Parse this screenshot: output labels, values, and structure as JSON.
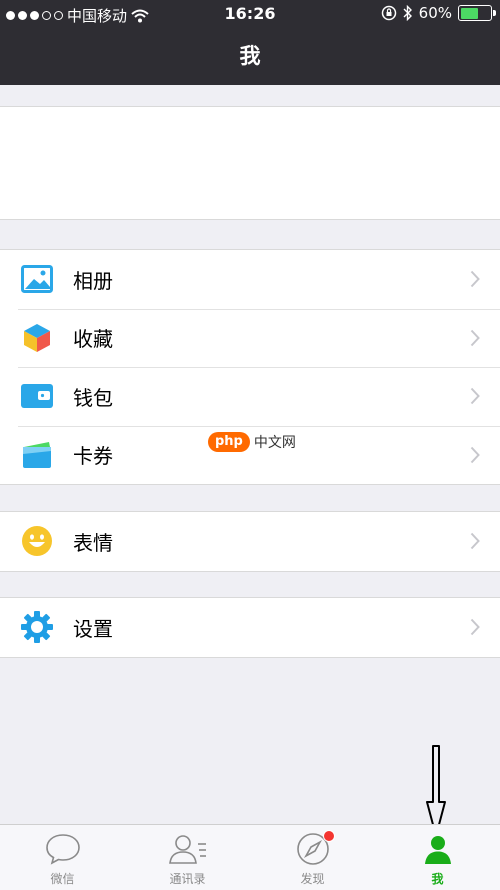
{
  "status_bar": {
    "carrier": "中国移动",
    "time": "16:26",
    "battery": "60%",
    "battery_level": 0.6
  },
  "nav": {
    "title": "我"
  },
  "menu": {
    "group1": [
      {
        "label": "相册",
        "icon": "photo-album-icon",
        "color": "#2aa7e8"
      },
      {
        "label": "收藏",
        "icon": "favorites-cube-icon",
        "color": "#f5c12a"
      },
      {
        "label": "钱包",
        "icon": "wallet-icon",
        "color": "#2aa7e8"
      },
      {
        "label": "卡券",
        "icon": "card-coupon-icon",
        "color": "#2aa7e8"
      }
    ],
    "group2": [
      {
        "label": "表情",
        "icon": "smiley-icon",
        "color": "#f7c52b"
      }
    ],
    "group3": [
      {
        "label": "设置",
        "icon": "gear-icon",
        "color": "#1f9ee5"
      }
    ]
  },
  "watermark": {
    "badge": "php",
    "text": "中文网"
  },
  "tabbar": {
    "tabs": [
      {
        "label": "微信",
        "icon": "chat-bubble-icon"
      },
      {
        "label": "通讯录",
        "icon": "contacts-icon"
      },
      {
        "label": "发现",
        "icon": "compass-icon",
        "badge": true
      },
      {
        "label": "我",
        "icon": "me-person-icon",
        "active": true
      }
    ],
    "active_color": "#1aad19"
  }
}
